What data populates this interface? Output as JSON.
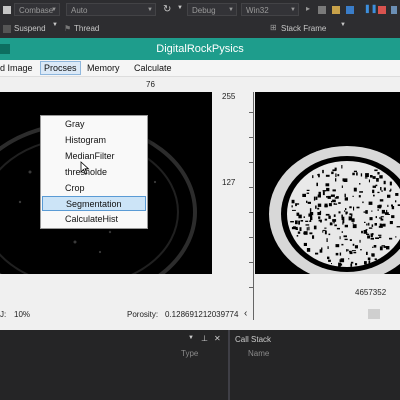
{
  "ide": {
    "solution_config": "Combase",
    "platform": "Auto",
    "debug_config": "Debug",
    "target": "Win32",
    "suspend_label": "Suspend",
    "thread_label": "Thread",
    "stack_frame_label": "Stack Frame"
  },
  "window": {
    "title": "DigitalRockPysics"
  },
  "menu": {
    "items": [
      "d Image",
      "Procses",
      "Memory",
      "Calculate"
    ],
    "open_menu": "Procses",
    "dropdown": [
      "Gray",
      "Histogram",
      "MedianFilter",
      " thresholde",
      "Crop",
      "Segmentation",
      "CalculateHist"
    ],
    "highlighted": "Segmentation"
  },
  "image": {
    "top_label": "76",
    "axis_top": "255",
    "axis_mid": "127",
    "axis_right": "4657352"
  },
  "status": {
    "zoom_label": "J:",
    "zoom_value": "10%",
    "porosity_label": "Porosity:",
    "porosity_value": "0.128691212039774"
  },
  "panels": {
    "left_col": "Type",
    "right_title": "Call Stack",
    "right_col": "Name"
  }
}
